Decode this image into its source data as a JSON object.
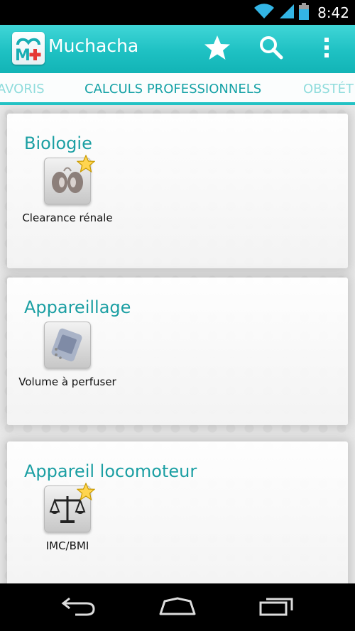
{
  "status_bar": {
    "time": "8:42"
  },
  "action_bar": {
    "title": "Muchacha",
    "favorites_icon": "star-icon",
    "search_icon": "search-icon",
    "overflow_icon": "overflow-menu-icon"
  },
  "tabs": {
    "left": "AVORIS",
    "center": "CALCULS PROFESSIONNELS",
    "right": "OBSTÉT"
  },
  "sections": [
    {
      "title": "Biologie",
      "tools": [
        {
          "label": "Clearance rénale",
          "icon": "kidneys-icon",
          "favorite": true
        }
      ]
    },
    {
      "title": "Appareillage",
      "tools": [
        {
          "label": "Volume à perfuser",
          "icon": "iv-bag-icon",
          "favorite": false
        }
      ]
    },
    {
      "title": "Appareil locomoteur",
      "tools": [
        {
          "label": "IMC/BMI",
          "icon": "scale-icon",
          "favorite": true
        }
      ]
    }
  ],
  "colors": {
    "accent": "#1ec1c3",
    "section_title": "#1b9fa3"
  }
}
